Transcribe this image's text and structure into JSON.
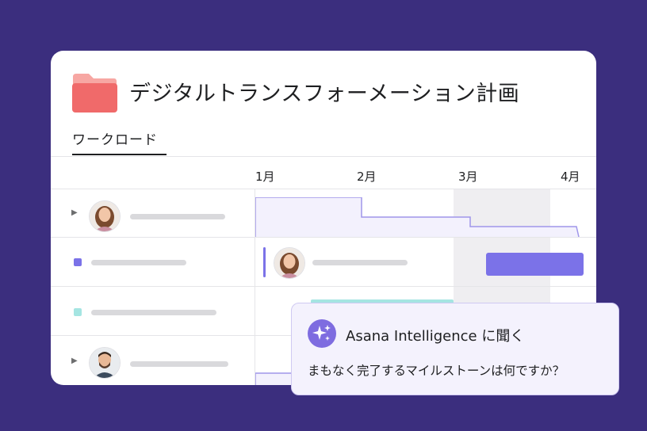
{
  "project": {
    "title": "デジタルトランスフォーメーション計画",
    "icon": "folder-icon",
    "folder_color": "#f06a6a"
  },
  "tabs": [
    {
      "label": "ワークロード",
      "active": true
    }
  ],
  "timeline": {
    "months": [
      "1月",
      "2月",
      "3月",
      "4月"
    ]
  },
  "rows": [
    {
      "type": "person",
      "expandable": true
    },
    {
      "type": "task",
      "marker_color": "#7b72e8"
    },
    {
      "type": "task",
      "marker_color": "#a5e5e2"
    },
    {
      "type": "person",
      "expandable": true
    }
  ],
  "colors": {
    "background": "#3b2e7e",
    "accent": "#7b72e8",
    "workload_fill": "#f3f1fd",
    "teal": "#a5e5e2"
  },
  "ai_prompt": {
    "title": "Asana Intelligence に聞く",
    "question": "まもなく完了するマイルストーンは何ですか？",
    "icon": "sparkle-icon"
  }
}
